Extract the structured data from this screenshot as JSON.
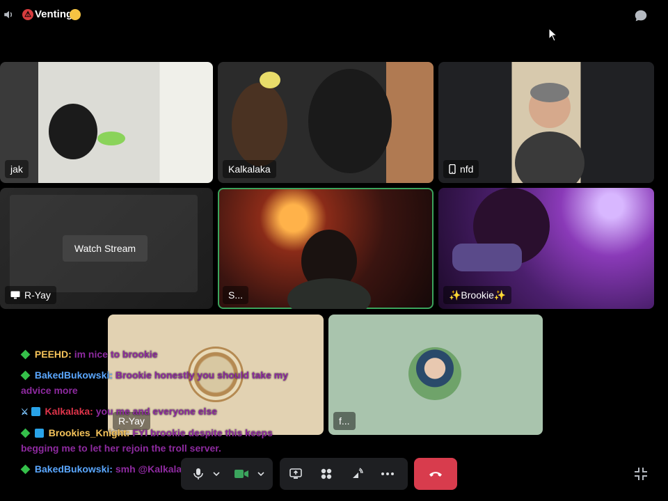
{
  "channel": {
    "title": "Venting"
  },
  "participants": {
    "jak": "jak",
    "kalkalaka": "Kalkalaka",
    "nfd": "nfd",
    "ryay": "R-Yay",
    "s": "S...",
    "brookie": "✨Brookie✨",
    "ryay_bottom": "R-Yay",
    "f": "f..."
  },
  "stream": {
    "watch_label": "Watch Stream"
  },
  "chat": [
    {
      "user": "PEEHD:",
      "text": "im nice to brookie"
    },
    {
      "user": "BakedBukowski:",
      "text": "Brookie honestly you should take my advice more"
    },
    {
      "user": "Kalkalaka:",
      "text": "you me and everyone else"
    },
    {
      "user": "Brookies_Knight:",
      "text": "FYI brookie despite this keeps begging me to let her rejoin the troll server."
    },
    {
      "user": "BakedBukowski:",
      "text": "smh @Kalkalaka it's so annoying"
    }
  ],
  "colors": {
    "speaking_outline": "#3ba55d",
    "end_call": "#d83c4d",
    "control_bg": "#1e1f22"
  }
}
